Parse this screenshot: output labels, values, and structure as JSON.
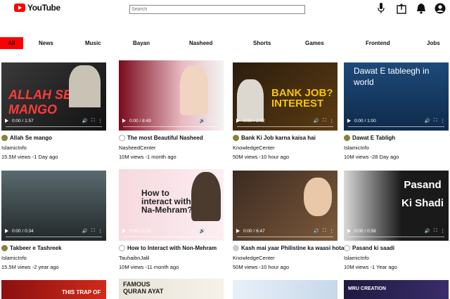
{
  "header": {
    "logo_text": "YouTube",
    "search_placeholder": "Search",
    "icons": [
      "mic-icon",
      "upload-icon",
      "bell-icon",
      "account-icon"
    ]
  },
  "categories": [
    "All",
    "News",
    "Music",
    "Bayan",
    "Nasheed",
    "Shorts",
    "Games",
    "Frontend",
    "Jobs"
  ],
  "videos": [
    {
      "title": "Allah Se mango",
      "channel": "IslamicInfo",
      "stats": "15.5M views -1 Day ago",
      "time": "0:00 / 1:57",
      "thumb_text": "ALLAH SE MANGO",
      "progress": 0.1
    },
    {
      "title": "The most Beautiful Nasheed",
      "channel": "NasheedCenter",
      "stats": "10M views -1 month ago",
      "time": "0:00 / 8:49",
      "thumb_text": "",
      "progress": 0.0
    },
    {
      "title": "Bank Ki Job karna kaisa hai",
      "channel": "KnowledgeCenter",
      "stats": "50M views -10 hour ago",
      "time": "0:00 / 2:02",
      "thumb_text": "BANK JOB? INTEREST",
      "progress": 0.0
    },
    {
      "title": "Dawat E Tabligh",
      "channel": "IslamicInfo",
      "stats": "10M views -28 Day ago",
      "time": "0:00 / 1:00",
      "thumb_text": "Dawat E tableegh in world",
      "progress": 0.0
    },
    {
      "title": "Takbeer e Tashreek",
      "channel": "IslamicInfo",
      "stats": "15.5M views -2 year ago",
      "time": "0:00 / 0:34",
      "thumb_text": "",
      "progress": 0.0
    },
    {
      "title": "How to Interact with Non-Mehram",
      "channel": "TauhaibnJalil",
      "stats": "10M views -11 month ago",
      "time": "0:00 / 2:24",
      "thumb_text": "How to interact with Na-Mehram?",
      "progress": 0.0
    },
    {
      "title": "Kash mai yaar Philistine ka waasi hota",
      "channel": "KnowledgeCenter",
      "stats": "50M views -10 hour ago",
      "time": "0:00 / 6:47",
      "thumb_text": "",
      "progress": 0.0
    },
    {
      "title": "Pasand ki saadi",
      "channel": "IslamicInfo",
      "stats": "10M views -1 Year ago",
      "time": "0:00 / 0:58",
      "thumb_text": "Pasand Ki Shadi",
      "progress": 0.0
    }
  ],
  "bottom_row_text": [
    "THIS TRAP OF",
    "FAMOUS QURAN AYAT",
    "",
    "MRU CREATION"
  ]
}
